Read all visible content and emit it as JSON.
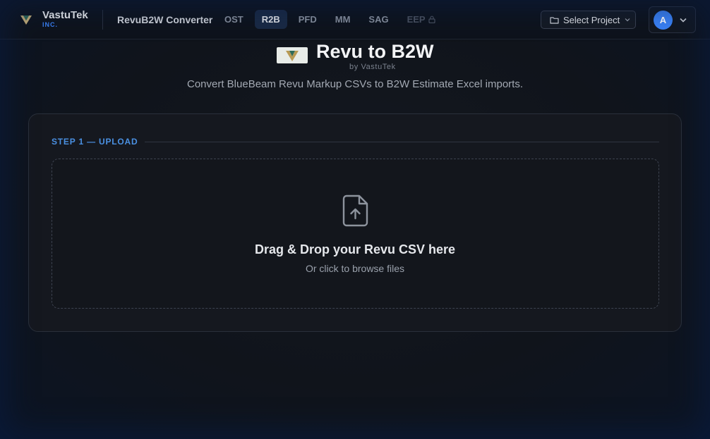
{
  "brand": {
    "name": "VastuTek",
    "sub": "INC.",
    "logo_icon": "vastutek-logo-icon"
  },
  "app_title": "RevuB2W Converter",
  "tabs": [
    {
      "label": "OST",
      "active": false,
      "disabled": false
    },
    {
      "label": "R2B",
      "active": true,
      "disabled": false
    },
    {
      "label": "PFD",
      "active": false,
      "disabled": false
    },
    {
      "label": "MM",
      "active": false,
      "disabled": false
    },
    {
      "label": "SAG",
      "active": false,
      "disabled": false
    },
    {
      "label": "EEP",
      "active": false,
      "disabled": true,
      "icon": "lock-icon"
    }
  ],
  "project_select": {
    "label": "Select Project",
    "icon": "folder-icon"
  },
  "user": {
    "initial": "A"
  },
  "hero": {
    "title": "Revu to B2W",
    "by": "by VastuTek",
    "description": "Convert BlueBeam Revu Markup CSVs to B2W Estimate Excel imports."
  },
  "upload": {
    "step_label": "STEP 1 — UPLOAD",
    "title": "Drag & Drop your Revu CSV here",
    "subtitle": "Or click to browse files",
    "icon": "file-upload-icon"
  },
  "colors": {
    "accent": "#3b82f6",
    "background": "#0a0f1a",
    "card": "#15181f"
  }
}
